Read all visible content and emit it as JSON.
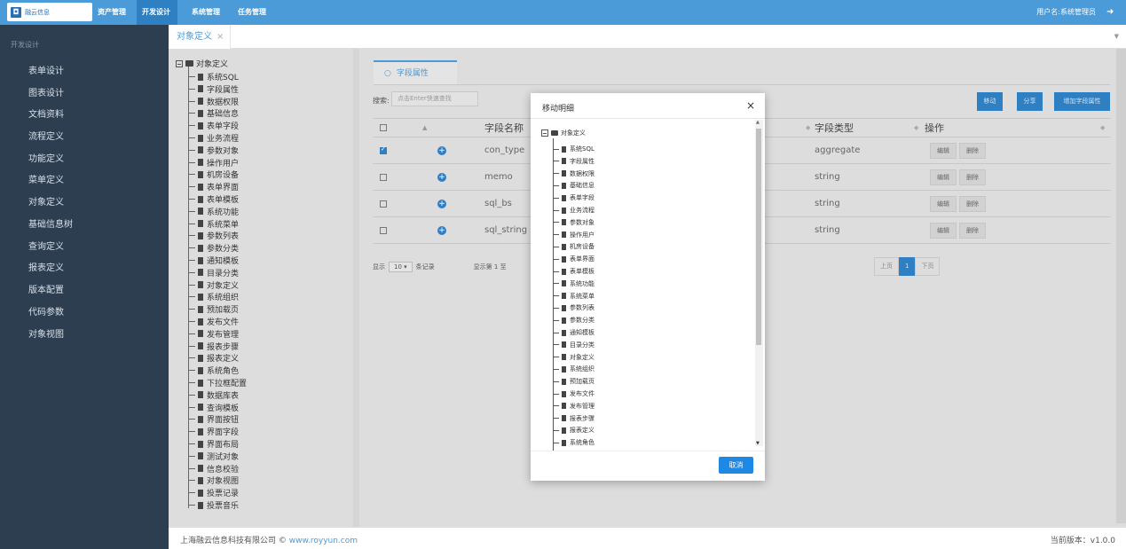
{
  "header": {
    "logo_text": "融云信息",
    "nav": [
      "资产管理",
      "开发设计",
      "系统管理",
      "任务管理"
    ],
    "active_nav": "开发设计",
    "user_label": "用户名:系统管理员"
  },
  "sidebar": {
    "title": "开发设计",
    "items": [
      "表单设计",
      "图表设计",
      "文档资料",
      "流程定义",
      "功能定义",
      "菜单定义",
      "对象定义",
      "基础信息树",
      "查询定义",
      "报表定义",
      "版本配置",
      "代码参数",
      "对象视图"
    ]
  },
  "tabs": {
    "active": "对象定义",
    "close": "×"
  },
  "tree": {
    "root": "对象定义",
    "nodes": [
      "系统SQL",
      "字段属性",
      "数据权限",
      "基础信息",
      "表单字段",
      "业务流程",
      "参数对象",
      "操作用户",
      "机房设备",
      "表单界面",
      "表单模板",
      "系统功能",
      "系统菜单",
      "参数列表",
      "参数分类",
      "通知模板",
      "目录分类",
      "对象定义",
      "系统组织",
      "预加载页",
      "发布文件",
      "发布管理",
      "报表步骤",
      "报表定义",
      "系统角色",
      "下拉框配置",
      "数据库表",
      "查询模板",
      "界面按钮",
      "界面字段",
      "界面布局",
      "测试对象",
      "信息校验",
      "对象视图",
      "投票记录",
      "投票音乐"
    ]
  },
  "main": {
    "section_tab": "字段属性",
    "search_label": "搜索:",
    "search_placeholder": "点击Enter快速查找",
    "buttons": {
      "move": "移动",
      "share": "分享",
      "add": "增加字段属性"
    },
    "columns": [
      "字段名称",
      "字段类型",
      "操作"
    ],
    "rows": [
      {
        "checked": true,
        "name": "con_type",
        "type": "aggregate"
      },
      {
        "checked": false,
        "name": "memo",
        "type": "string"
      },
      {
        "checked": false,
        "name": "sql_bs",
        "type": "string"
      },
      {
        "checked": false,
        "name": "sql_string",
        "type": "string"
      }
    ],
    "row_actions": {
      "edit": "编辑",
      "delete": "删除"
    },
    "pager": {
      "show": "显示",
      "page_size": "10",
      "records": "条记录",
      "info": "显示第 1 至",
      "prev": "上页",
      "current": "1",
      "next": "下页"
    }
  },
  "modal": {
    "title": "移动明细",
    "close": "×",
    "root": "对象定义",
    "nodes": [
      "系统SQL",
      "字段属性",
      "数据权限",
      "基础信息",
      "表单字段",
      "业务流程",
      "参数对象",
      "操作用户",
      "机房设备",
      "表单界面",
      "表单模板",
      "系统功能",
      "系统菜单",
      "参数列表",
      "参数分类",
      "通知模板",
      "目录分类",
      "对象定义",
      "系统组织",
      "预加载页",
      "发布文件",
      "发布管理",
      "报表步骤",
      "报表定义",
      "系统角色"
    ],
    "cancel": "取消"
  },
  "footer": {
    "company": "上海融云信息科技有限公司 ©",
    "link": "www.royyun.com",
    "version": "当前版本：v1.0.0"
  }
}
